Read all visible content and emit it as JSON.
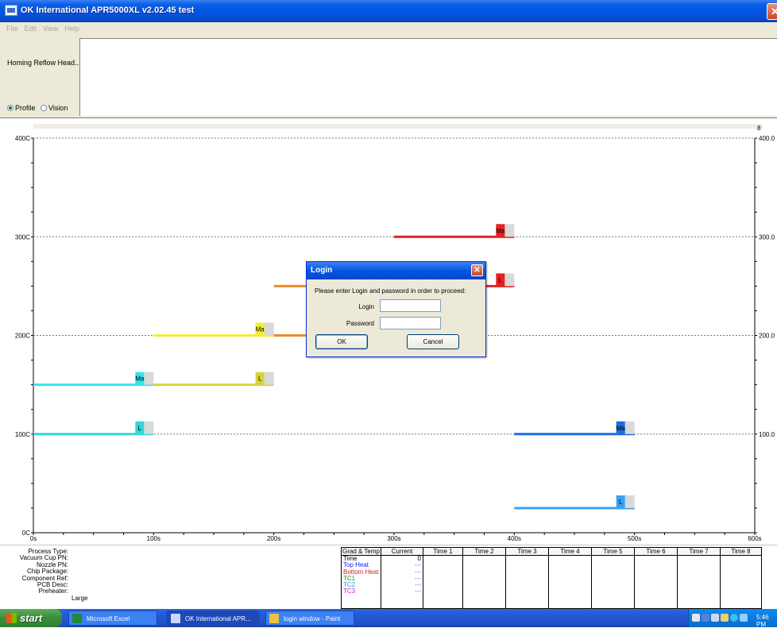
{
  "window": {
    "title": "OK International  APR5000XL  v2.02.45 test",
    "close_icon": "close-icon"
  },
  "menu": [
    "File",
    "Edit",
    "View",
    "Help"
  ],
  "top_panel": {
    "status_text": "Homing Reflow Head...",
    "mode_options": [
      {
        "label": "Profile",
        "selected": true
      },
      {
        "label": "Vision",
        "selected": false
      }
    ]
  },
  "chart_data": {
    "type": "line",
    "x_ticks": [
      "0s",
      "100s",
      "200s",
      "300s",
      "400s",
      "500s",
      "600s"
    ],
    "y_ticks_left": [
      "0C",
      "100C",
      "200C",
      "300C",
      "400C"
    ],
    "y_ticks_right": [
      "100.0",
      "200.0",
      "300.0",
      "400.0"
    ],
    "right_axis_top_label": "8",
    "xlim": [
      0,
      600
    ],
    "ylim": [
      0,
      400
    ],
    "grid": "dotted horizontal at 100, 200, 300, 400",
    "segments": [
      {
        "x0": 0,
        "x1": 100,
        "y": 100,
        "color": "#33d7d7",
        "marker": "L"
      },
      {
        "x0": 0,
        "x1": 100,
        "y": 150,
        "color": "#33e5ea",
        "marker": "Ma"
      },
      {
        "x0": 100,
        "x1": 200,
        "y": 150,
        "color": "#d6d43c",
        "marker": "L"
      },
      {
        "x0": 100,
        "x1": 200,
        "y": 200,
        "color": "#f3ee31",
        "marker": "Ma"
      },
      {
        "x0": 200,
        "x1": 240,
        "y": 200,
        "color": "#ee8a26",
        "marker": null
      },
      {
        "x0": 200,
        "x1": 240,
        "y": 250,
        "color": "#ee8a26",
        "marker": null
      },
      {
        "x0": 300,
        "x1": 400,
        "y": 300,
        "color": "#e52222",
        "marker": "Ma"
      },
      {
        "x0": 370,
        "x1": 400,
        "y": 250,
        "color": "#e52222",
        "marker": "L"
      },
      {
        "x0": 400,
        "x1": 500,
        "y": 100,
        "color": "#1c6fe0",
        "marker": "Ma"
      },
      {
        "x0": 400,
        "x1": 500,
        "y": 25,
        "color": "#3aa0f0",
        "marker": "L"
      }
    ]
  },
  "specs": {
    "labels": [
      "Process Type:",
      "Vacuum Cup PN:",
      "Nozzle PN:",
      "Chip Package:",
      "Component Ref:",
      "PCB Desc:",
      "Preheater:"
    ],
    "preheater_value": "Large"
  },
  "readout": {
    "headers": [
      "Grad & Temp",
      "Current",
      "Time 1",
      "Time 2",
      "Time 3",
      "Time 4",
      "Time 5",
      "Time 6",
      "Time 7",
      "Time 8"
    ],
    "params": [
      "Time",
      "Top Heat",
      "Bottom Heat",
      "TC1",
      "TC2",
      "TC3"
    ],
    "current": [
      "0",
      "---",
      "---",
      "---",
      "---",
      "---"
    ]
  },
  "dialog": {
    "title": "Login",
    "prompt": "Please enter Login and password in order to proceed:",
    "login_label": "Login",
    "password_label": "Password",
    "ok_label": "OK",
    "cancel_label": "Cancel"
  },
  "taskbar": {
    "start_label": "start",
    "tasks": [
      {
        "label": "Microsoft Excel",
        "icon_color": "#1e8a3a"
      },
      {
        "label": "OK International APR...",
        "icon_color": "#c8d8f8"
      },
      {
        "label": "login window - Paint",
        "icon_color": "#f0c040"
      }
    ],
    "clock": "5:46 PM"
  }
}
